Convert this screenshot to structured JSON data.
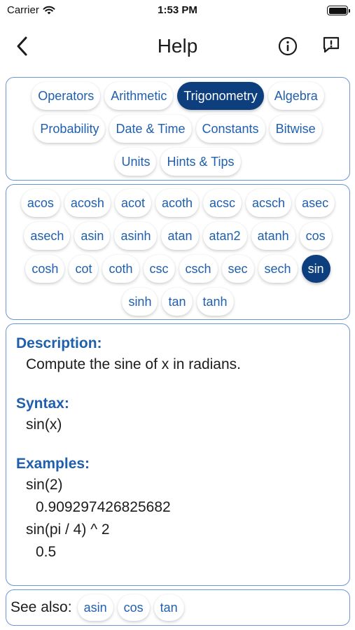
{
  "status_bar": {
    "carrier": "Carrier",
    "time": "1:53 PM"
  },
  "nav": {
    "title": "Help",
    "back_icon": "chevron-left-icon",
    "info_icon": "info-circle-icon",
    "feedback_icon": "exclamation-bubble-icon"
  },
  "categories": {
    "items": [
      "Operators",
      "Arithmetic",
      "Trigonometry",
      "Algebra",
      "Probability",
      "Date & Time",
      "Constants",
      "Bitwise",
      "Units",
      "Hints & Tips"
    ],
    "selected": "Trigonometry"
  },
  "functions": {
    "items": [
      "acos",
      "acosh",
      "acot",
      "acoth",
      "acsc",
      "acsch",
      "asec",
      "asech",
      "asin",
      "asinh",
      "atan",
      "atan2",
      "atanh",
      "cos",
      "cosh",
      "cot",
      "coth",
      "csc",
      "csch",
      "sec",
      "sech",
      "sin",
      "sinh",
      "tan",
      "tanh"
    ],
    "selected": "sin"
  },
  "detail": {
    "description_heading": "Description:",
    "description": "Compute the sine of x in radians.",
    "syntax_heading": "Syntax:",
    "syntax": "sin(x)",
    "examples_heading": "Examples:",
    "examples": [
      {
        "input": "sin(2)",
        "output": "0.909297426825682"
      },
      {
        "input": "sin(pi / 4) ^ 2",
        "output": "0.5"
      }
    ]
  },
  "see_also": {
    "label": "See also:",
    "items": [
      "asin",
      "cos",
      "tan"
    ]
  },
  "colors": {
    "accent": "#1f5fae",
    "selected": "#0d3f7f",
    "border": "#6c95d4"
  }
}
